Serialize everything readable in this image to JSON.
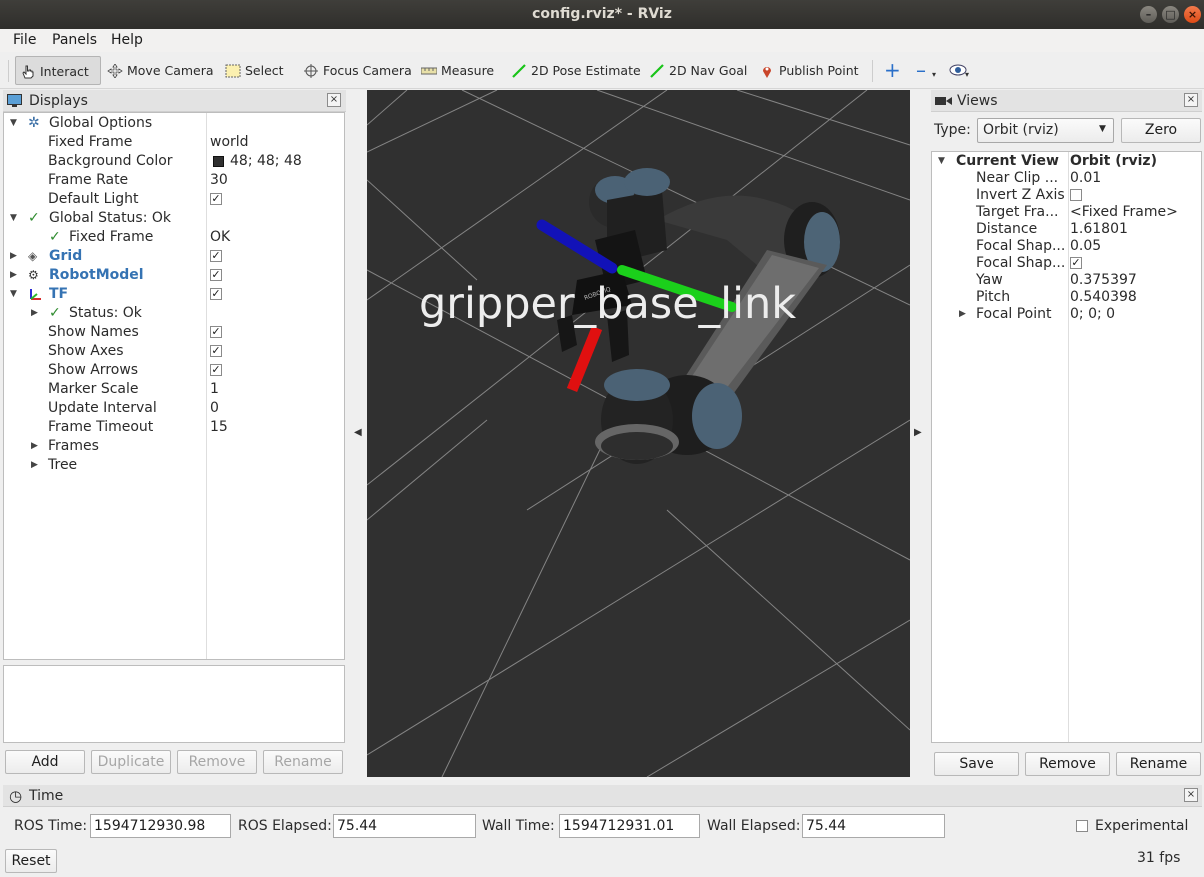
{
  "window": {
    "title": "config.rviz* - RViz"
  },
  "menu": [
    {
      "label": "File"
    },
    {
      "label": "Panels"
    },
    {
      "label": "Help"
    }
  ],
  "toolbar": {
    "tools": [
      {
        "label": "Interact",
        "icon": "hand-pointer-icon",
        "active": true
      },
      {
        "label": "Move Camera",
        "icon": "move-camera-icon"
      },
      {
        "label": "Select",
        "icon": "select-rect-icon"
      },
      {
        "label": "Focus Camera",
        "icon": "focus-camera-icon"
      },
      {
        "label": "Measure",
        "icon": "ruler-icon"
      },
      {
        "label": "2D Pose Estimate",
        "icon": "green-arrow-icon"
      },
      {
        "label": "2D Nav Goal",
        "icon": "green-arrow-icon"
      },
      {
        "label": "Publish Point",
        "icon": "map-pin-icon"
      }
    ],
    "extras": [
      {
        "icon": "plus-icon"
      },
      {
        "icon": "minus-icon"
      },
      {
        "icon": "eye-icon"
      }
    ]
  },
  "displays": {
    "title": "Displays",
    "global_options": {
      "label": "Global Options"
    },
    "fixed_frame": {
      "label": "Fixed Frame",
      "value": "world"
    },
    "background_color": {
      "label": "Background Color",
      "value": "48; 48; 48",
      "swatch": "#303030"
    },
    "frame_rate": {
      "label": "Frame Rate",
      "value": "30"
    },
    "default_light": {
      "label": "Default Light",
      "checked": true
    },
    "global_status": {
      "label": "Global Status: Ok"
    },
    "gs_fixed_frame": {
      "label": "Fixed Frame",
      "value": "OK"
    },
    "grid": {
      "label": "Grid",
      "checked": true
    },
    "robot_model": {
      "label": "RobotModel",
      "checked": true
    },
    "tf": {
      "label": "TF",
      "checked": true
    },
    "tf_status": {
      "label": "Status: Ok"
    },
    "show_names": {
      "label": "Show Names",
      "checked": true
    },
    "show_axes": {
      "label": "Show Axes",
      "checked": true
    },
    "show_arrows": {
      "label": "Show Arrows",
      "checked": true
    },
    "marker_scale": {
      "label": "Marker Scale",
      "value": "1"
    },
    "update_interval": {
      "label": "Update Interval",
      "value": "0"
    },
    "frame_timeout": {
      "label": "Frame Timeout",
      "value": "15"
    },
    "frames": {
      "label": "Frames"
    },
    "tree": {
      "label": "Tree"
    },
    "buttons": {
      "add": "Add",
      "duplicate": "Duplicate",
      "remove": "Remove",
      "rename": "Rename"
    }
  },
  "viewport": {
    "frame_label": "gripper_base_link",
    "background": "#303030"
  },
  "views": {
    "title": "Views",
    "type_label": "Type:",
    "type_value": "Orbit (rviz)",
    "zero_button": "Zero",
    "current_view": {
      "label": "Current View",
      "value": "Orbit (rviz)"
    },
    "near_clip": {
      "label": "Near Clip ...",
      "value": "0.01"
    },
    "invert_z": {
      "label": "Invert Z Axis",
      "checked": false
    },
    "target_frame": {
      "label": "Target Fra...",
      "value": "<Fixed Frame>"
    },
    "distance": {
      "label": "Distance",
      "value": "1.61801"
    },
    "focal_shape_size": {
      "label": "Focal Shap...",
      "value": "0.05"
    },
    "focal_shape_fixed": {
      "label": "Focal Shap...",
      "checked": true
    },
    "yaw": {
      "label": "Yaw",
      "value": "0.375397"
    },
    "pitch": {
      "label": "Pitch",
      "value": "0.540398"
    },
    "focal_point": {
      "label": "Focal Point",
      "value": "0; 0; 0"
    },
    "buttons": {
      "save": "Save",
      "remove": "Remove",
      "rename": "Rename"
    }
  },
  "time": {
    "title": "Time",
    "ros_time": {
      "label": "ROS Time:",
      "value": "1594712930.98"
    },
    "ros_elapsed": {
      "label": "ROS Elapsed:",
      "value": "75.44"
    },
    "wall_time": {
      "label": "Wall Time:",
      "value": "1594712931.01"
    },
    "wall_elapsed": {
      "label": "Wall Elapsed:",
      "value": "75.44"
    },
    "experimental": {
      "label": "Experimental",
      "checked": false
    },
    "reset": "Reset",
    "fps": "31 fps"
  }
}
